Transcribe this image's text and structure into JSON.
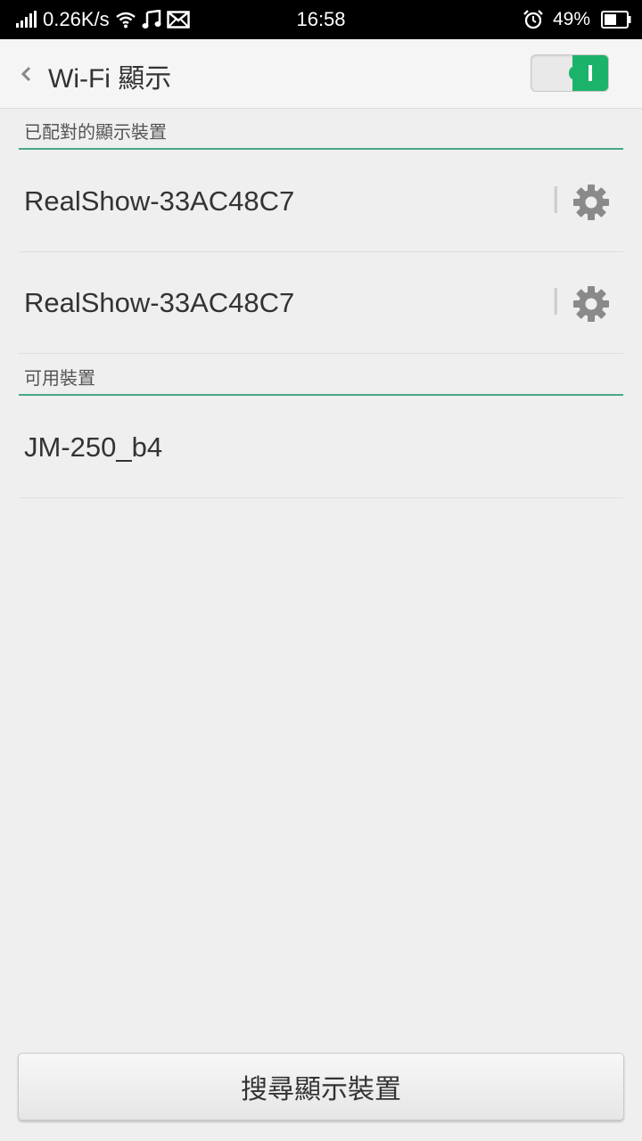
{
  "status_bar": {
    "net_speed": "0.26K/s",
    "time": "16:58",
    "battery": "49%",
    "icons": [
      "signal-icon",
      "wifi-icon",
      "music-icon",
      "mail-icon",
      "alarm-icon",
      "battery-icon"
    ]
  },
  "header": {
    "title": "Wi-Fi 顯示",
    "toggle_state": "on"
  },
  "sections": {
    "paired_label": "已配對的顯示裝置",
    "paired_devices": [
      {
        "name": "RealShow-33AC48C7"
      },
      {
        "name": "RealShow-33AC48C7"
      }
    ],
    "available_label": "可用裝置",
    "available_devices": [
      {
        "name": "JM-250_b4"
      }
    ]
  },
  "actions": {
    "search_label": "搜尋顯示裝置"
  },
  "colors": {
    "accent": "#1bb36a",
    "section_line": "#4aa883",
    "background": "#efefef"
  }
}
